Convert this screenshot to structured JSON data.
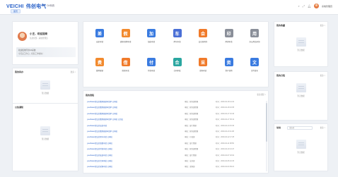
{
  "header": {
    "logo_en": "VEICHI",
    "logo_cn": "伟创电气",
    "system_name": "OA系统",
    "home_tab": "首页",
    "user_name": "系统管理员",
    "icons": [
      "search-icon",
      "fullscreen-icon",
      "bell-icon"
    ]
  },
  "profile": {
    "name": "小王，欢迎回来",
    "dept": "信息化部 · 系统管理员",
    "banner_line1": "欢迎使用伟创OA系统",
    "banner_line2": "今天是工作日，祝您工作愉快！"
  },
  "todo": {
    "title": "我的待办",
    "more": "更多 >",
    "empty": "暂无数据"
  },
  "notice": {
    "title": "公告通知",
    "empty": "暂无数据"
  },
  "apps": [
    {
      "label": "出差申请",
      "color": "#3a7be0",
      "glyph": "差"
    },
    {
      "label": "请假/调休申请",
      "color": "#f28a2e",
      "glyph": "假"
    },
    {
      "label": "加班申请",
      "color": "#3a7be0",
      "glyph": "加"
    },
    {
      "label": "用车申请",
      "color": "#4a6fd6",
      "glyph": "车"
    },
    {
      "label": "会议室预约",
      "color": "#f07a2a",
      "glyph": "会"
    },
    {
      "label": "用印申请",
      "color": "#8a8f99",
      "glyph": "印"
    },
    {
      "label": "办公用品申领",
      "color": "#8a8f99",
      "glyph": "用"
    },
    {
      "label": "费用报销",
      "color": "#f28a2e",
      "glyph": "费"
    },
    {
      "label": "借款申请",
      "color": "#f07a2a",
      "glyph": "借"
    },
    {
      "label": "付款申请",
      "color": "#3a7be0",
      "glyph": "付"
    },
    {
      "label": "合同审批",
      "color": "#2aa6a0",
      "glyph": "合"
    },
    {
      "label": "采购申请",
      "color": "#f07a2a",
      "glyph": "采"
    },
    {
      "label": "资产领用",
      "color": "#3a7be0",
      "glyph": "资"
    },
    {
      "label": "文件发布",
      "color": "#3a7be0",
      "glyph": "文"
    }
  ],
  "process": {
    "title": "我的流程",
    "more": "更多流程 >",
    "rows": [
      {
        "title": "yueshaoer提交的费用报销申请单 已审批",
        "node": "审批：财务部经理",
        "date": "时间：2023-04-18 14:22"
      },
      {
        "title": "yueshaoer提交的费用报销申请单 已审批",
        "node": "审批：财务部经理",
        "date": "时间：2023-04-18 10:05"
      },
      {
        "title": "yueshaoer提交的费用报销申请单 已审批",
        "node": "审批：财务部经理",
        "date": "时间：2023-04-17 16:40"
      },
      {
        "title": "yueshaoer提交的费用报销申请单 已审批 已完成",
        "node": "审批：财务部经理",
        "date": "时间：2023-04-17 09:12"
      },
      {
        "title": "yueshaoer提交的出差申请",
        "node": "审批：部门经理",
        "date": "时间：2023-04-14 15:30"
      },
      {
        "title": "yueshaoer提交的费用报销申请单 已审批",
        "node": "审批：财务部经理",
        "date": "时间：2023-04-13 11:08"
      },
      {
        "title": "yueshaoer提交的用车申请 已审批",
        "node": "审批：行政部",
        "date": "时间：2023-04-12 17:25"
      },
      {
        "title": "yueshaoer提交的请假申请 已审批",
        "node": "审批：部门经理",
        "date": "时间：2023-04-11 08:50"
      },
      {
        "title": "yueshaoer提交的付款申请 已审批",
        "node": "审批：财务部经理",
        "date": "时间：2023-04-10 13:47"
      },
      {
        "title": "yueshaoer提交的加班申请 已审批",
        "node": "审批：部门经理",
        "date": "时间：2023-04-07 18:02"
      },
      {
        "title": "yueshaoer提交的合同审批 已审批",
        "node": "审批：法务部",
        "date": "时间：2023-04-06 10:33"
      },
      {
        "title": "yueshaoer提交的采购申请 已审批",
        "node": "审批：采购部",
        "date": "时间：2023-04-04 09:21"
      }
    ]
  },
  "right": {
    "card1": {
      "title": "我的收藏",
      "more": "更多 >",
      "empty": "暂无数据"
    },
    "card2": {
      "title": "我的日程",
      "more": "更多 >",
      "empty": "暂无数据"
    },
    "card3": {
      "title": "常用",
      "filter": "请选择",
      "more": "更多 >",
      "empty": "暂无数据"
    }
  }
}
